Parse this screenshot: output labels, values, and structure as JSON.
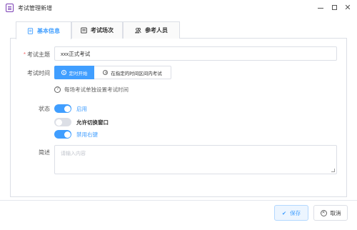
{
  "window": {
    "title": "考试管理新增",
    "minimize_glyph": "—",
    "close_glyph": "✕"
  },
  "tabs": [
    {
      "label": "基本信息",
      "icon": "document-icon",
      "active": true
    },
    {
      "label": "考试场次",
      "icon": "list-icon",
      "active": false
    },
    {
      "label": "参考人员",
      "icon": "users-icon",
      "active": false
    }
  ],
  "form": {
    "subject": {
      "label": "考试主题",
      "required_mark": "*",
      "value": "xxx正式考试"
    },
    "time": {
      "label": "考试时间",
      "options": [
        {
          "label": "定时开始",
          "selected": true
        },
        {
          "label": "在指定的时间区间内考试",
          "selected": false
        }
      ],
      "hint": "每场考试单独设置考试时间",
      "hint_icon_glyph": "?"
    },
    "status": {
      "label": "状态",
      "switches": [
        {
          "label": "启用",
          "on": true
        },
        {
          "label": "允许切换窗口",
          "on": false
        },
        {
          "label": "禁用右键",
          "on": true
        }
      ]
    },
    "description": {
      "label": "简述",
      "placeholder": "请输入内容",
      "value": ""
    }
  },
  "footer": {
    "save_label": "保存",
    "save_icon_glyph": "✔",
    "cancel_label": "取消",
    "cancel_icon_glyph": "✕"
  },
  "colors": {
    "accent": "#409eff",
    "border": "#dcdfe6",
    "required": "#f56c6c",
    "switch_off": "#dcdfe6",
    "app_icon": "#7b3fb5"
  }
}
